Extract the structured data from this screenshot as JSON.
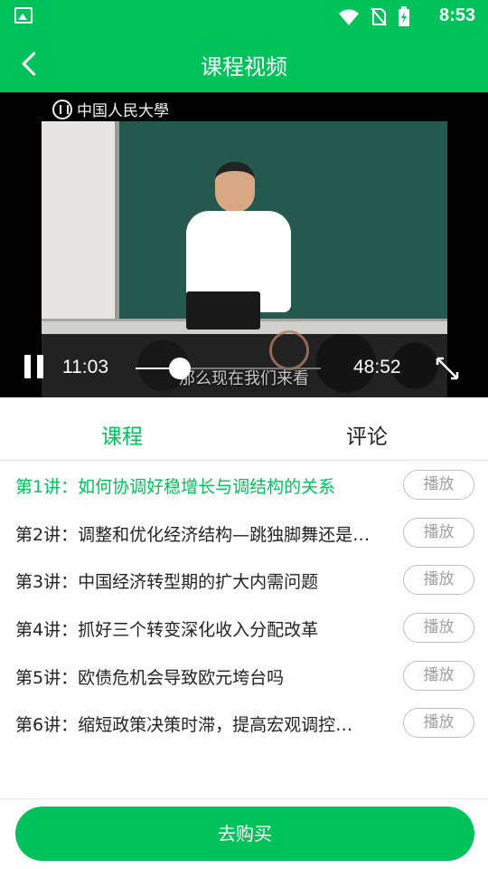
{
  "status": {
    "time": "8:53",
    "left_icon": "gallery-icon",
    "right_icons": [
      "wifi-icon",
      "no-sim-icon",
      "battery-charging-icon"
    ]
  },
  "header": {
    "title": "课程视频",
    "back_icon": "back-icon"
  },
  "player": {
    "watermark": "中国人民大學",
    "subtitle": "那么现在我们来看",
    "current_time": "11:03",
    "total_time": "48:52",
    "progress": 0.24,
    "pause_icon": "pause-icon",
    "fullscreen_icon": "fullscreen-icon"
  },
  "tabs": {
    "course": "课程",
    "comments": "评论",
    "active": "course"
  },
  "lessons": [
    {
      "title": "第1讲：如何协调好稳增长与调结构的关系",
      "button": "播放",
      "active": true
    },
    {
      "title": "第2讲：调整和优化经济结构—跳独脚舞还是…",
      "button": "播放",
      "active": false
    },
    {
      "title": "第3讲：中国经济转型期的扩大内需问题",
      "button": "播放",
      "active": false
    },
    {
      "title": "第4讲：抓好三个转变深化收入分配改革",
      "button": "播放",
      "active": false
    },
    {
      "title": "第5讲：欧债危机会导致欧元垮台吗",
      "button": "播放",
      "active": false
    },
    {
      "title": "第6讲：缩短政策决策时滞，提高宏观调控…",
      "button": "播放",
      "active": false
    }
  ],
  "footer": {
    "buy_label": "去购买"
  },
  "colors": {
    "accent": "#00c25a",
    "text": "#232323",
    "button_border": "#bfbfbf"
  }
}
